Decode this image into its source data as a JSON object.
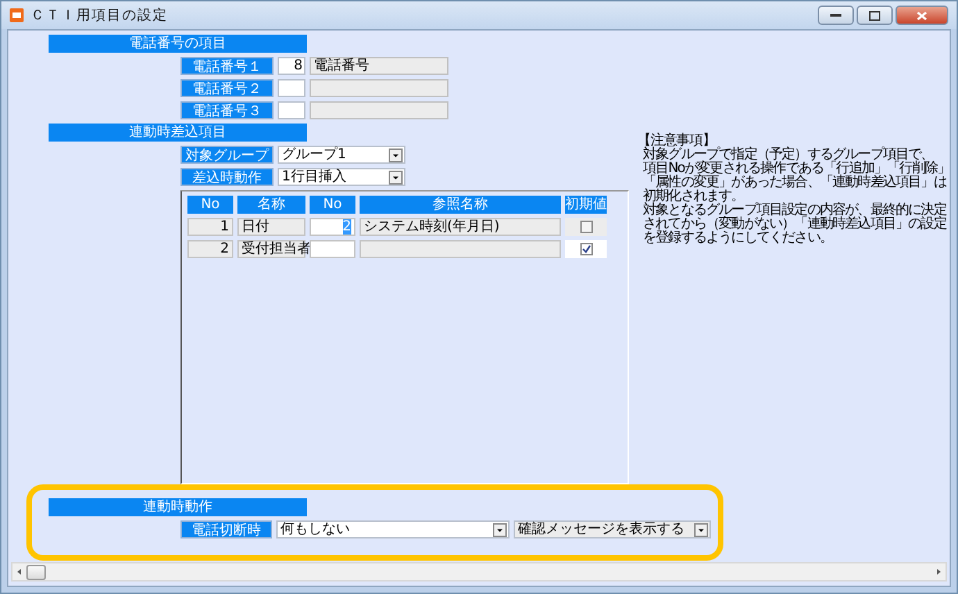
{
  "window": {
    "title": "ＣＴＩ用項目の設定"
  },
  "phone_section": {
    "heading": "電話番号の項目",
    "rows": [
      {
        "label": "電話番号１",
        "number": "8",
        "name": "電話番号"
      },
      {
        "label": "電話番号２"
      },
      {
        "label": "電話番号３"
      }
    ]
  },
  "insert_section": {
    "heading": "連動時差込項目",
    "fields": [
      {
        "label": "対象グループ",
        "value": "グループ1"
      },
      {
        "label": "差込時動作",
        "value": "1行目挿入"
      }
    ],
    "table": {
      "columns": [
        "No",
        "名称",
        "No",
        "参照名称",
        "初期値"
      ],
      "rows": [
        {
          "no": "1",
          "name": "日付",
          "ref_no": "2",
          "ref_no_selected": true,
          "ref_name": "システム時刻(年月日)",
          "initial": false
        },
        {
          "no": "2",
          "name": "受付担当者",
          "ref_no_selected": false,
          "initial": true
        }
      ]
    }
  },
  "notes": {
    "heading": "【注意事項】",
    "lines": [
      "対象グループで指定（予定）するグループ項目で、",
      "項目Noが変更される操作である「行追加」「行削除」",
      "「属性の変更」があった場合、「連動時差込項目」は",
      "初期化されます。",
      "対象となるグループ項目設定の内容が、最終的に決定",
      "されてから（変動がない）「連動時差込項目」の設定",
      "を登録するようにしてください。"
    ]
  },
  "action_section": {
    "heading": "連動時動作",
    "label": "電話切断時",
    "action": "何もしない",
    "confirm": "確認メッセージを表示する"
  }
}
